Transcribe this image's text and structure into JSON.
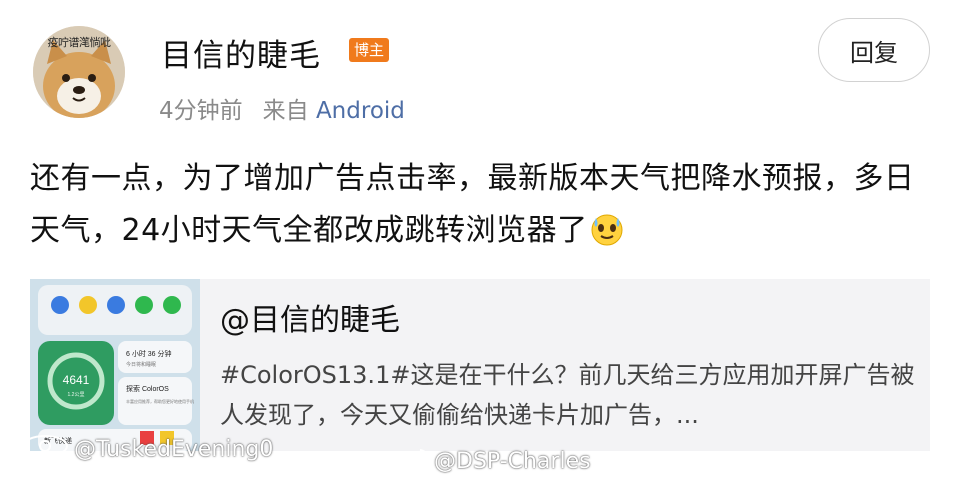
{
  "author": {
    "avatar_caption": "疫咛谱滗惝吡",
    "name": "目信的睫毛",
    "badge": "博主"
  },
  "meta": {
    "time": "4分钟前",
    "source_prefix": "来自",
    "source": "Android"
  },
  "reply_button": "回复",
  "post": {
    "text": "还有一点，为了增加广告点击率，最新版本天气把降水预报，多日天气，24小时天气全都改成跳转浏览器了",
    "emoji": "sweat-smile-emoji-icon"
  },
  "quoted_card": {
    "title": "@目信的睫毛",
    "description": "#ColorOS13.1#这是在干什么？前几天给三方应用加开屏广告被人发现了，今天又偷偷给快递卡片加广告，...",
    "thumbnail": {
      "steps_value": "4641",
      "steps_sub": "1.2公里",
      "sleep_label": "6 小时 36 分钟",
      "sleep_sub": "今日将和睡眠",
      "explore_label": "探索 ColorOS",
      "explore_sub": "丰富应用推荐，帮助您更好地使用手机",
      "express_label": "新飞快递"
    }
  },
  "watermarks": {
    "left": "@TuskedEvening0",
    "center": "@DSP-Charles"
  },
  "colors": {
    "badge": "#f07a1c",
    "source_link": "#4e6ea6",
    "card_bg": "#f3f3f5"
  }
}
